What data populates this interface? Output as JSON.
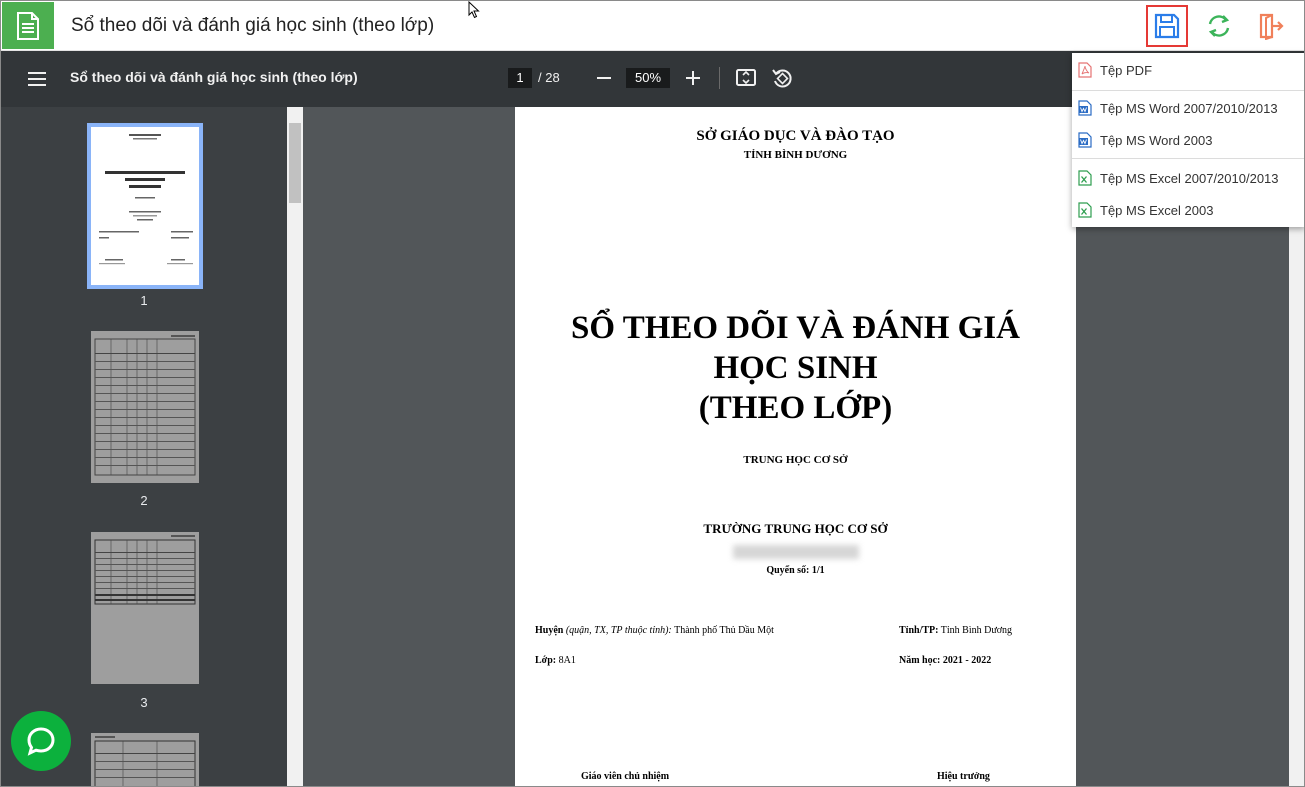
{
  "header": {
    "title": "Sổ theo dõi và đánh giá học sinh (theo lớp)",
    "actions": [
      {
        "name": "save",
        "icon": "floppy-disk-icon"
      },
      {
        "name": "refresh",
        "icon": "sync-arrows-icon"
      },
      {
        "name": "exit",
        "icon": "exit-door-icon"
      }
    ]
  },
  "viewer": {
    "title": "Sổ theo dõi và đánh giá học sinh (theo lớp)",
    "page_current": "1",
    "page_total": "/ 28",
    "zoom": "50%"
  },
  "thumbnails": [
    {
      "label": "1",
      "selected": true
    },
    {
      "label": "2",
      "selected": false
    },
    {
      "label": "3",
      "selected": false
    }
  ],
  "download_menu": {
    "items": [
      {
        "label": "Tệp PDF",
        "icon": "pdf-file-icon"
      },
      {
        "label": "Tệp MS Word 2007/2010/2013",
        "icon": "word-file-icon"
      },
      {
        "label": "Tệp MS Word 2003",
        "icon": "word-file-icon"
      },
      {
        "label": "Tệp MS Excel 2007/2010/2013",
        "icon": "excel-file-icon"
      },
      {
        "label": "Tệp MS Excel 2003",
        "icon": "excel-file-icon"
      }
    ]
  },
  "document": {
    "dept_line1": "SỞ GIÁO DỤC VÀ ĐÀO TẠO",
    "dept_line2": "TỈNH BÌNH DƯƠNG",
    "title_line1": "SỔ THEO DÕI VÀ ĐÁNH GIÁ",
    "title_line2": "HỌC SINH",
    "title_line3": "(THEO LỚP)",
    "level": "TRUNG HỌC CƠ SỞ",
    "school_label": "TRƯỜNG TRUNG HỌC CƠ SỞ",
    "volume": "Quyển số: 1/1",
    "district_label": "Huyện",
    "district_hint": "(quận, TX, TP thuộc tỉnh):",
    "district_value": "Thành phố Thủ Dầu Một",
    "province_label": "Tỉnh/TP:",
    "province_value": "Tỉnh Bình Dương",
    "class_label": "Lớp:",
    "class_value": "8A1",
    "year_label": "Năm học:",
    "year_value": "2021 - 2022",
    "teacher_label": "Giáo viên chủ nhiệm",
    "principal_label": "Hiệu trưởng"
  },
  "colors": {
    "accent_green": "#4caf50",
    "save_highlight": "#e53935",
    "toolbar": "#323639",
    "sidebar": "#3c4043",
    "viewer_bg": "#525659",
    "chat": "#0cb13d"
  }
}
